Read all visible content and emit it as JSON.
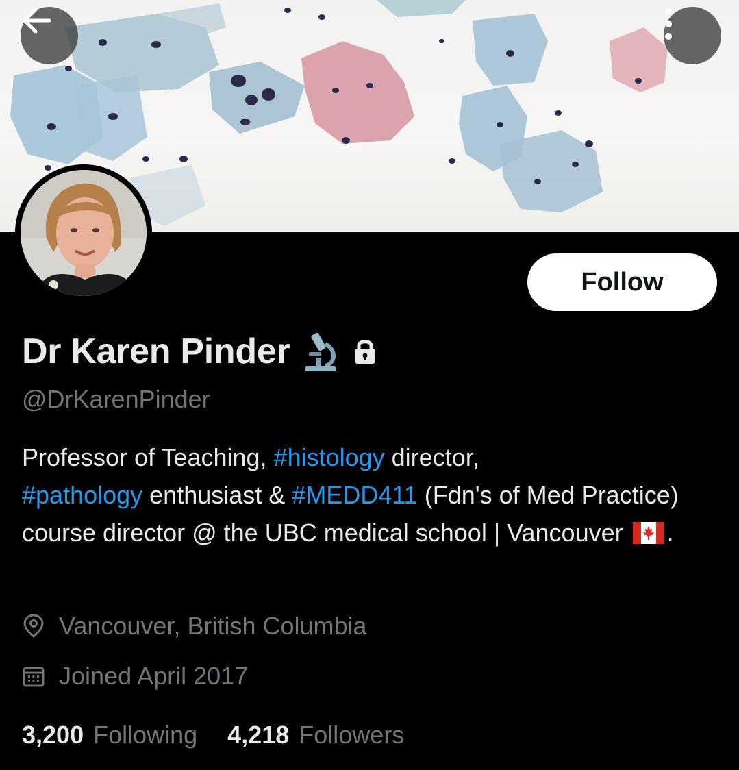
{
  "profile": {
    "display_name": "Dr Karen Pinder",
    "handle": "@DrKarenPinder",
    "follow_label": "Follow",
    "name_icons": [
      "microscope-icon",
      "lock-icon"
    ]
  },
  "bio": {
    "part1": "Professor of Teaching, ",
    "tag1": "#histology",
    "part2": " director,",
    "tag2": "#pathology",
    "part3": " enthusiast & ",
    "tag3": "#MEDD411",
    "part4": " (Fdn's of Med Practice) course director @ the UBC medical school | Vancouver",
    "part5": ".",
    "flag_icon": "canada-flag-icon"
  },
  "meta": {
    "location": "Vancouver, British Columbia",
    "joined": "Joined April 2017"
  },
  "stats": {
    "following_count": "3,200",
    "following_label": "Following",
    "followers_count": "4,218",
    "followers_label": "Followers"
  },
  "colors": {
    "background": "#000000",
    "text": "#e7e9ea",
    "muted": "#71767b",
    "link": "#1d9bf0",
    "follow_bg": "#ffffff"
  }
}
